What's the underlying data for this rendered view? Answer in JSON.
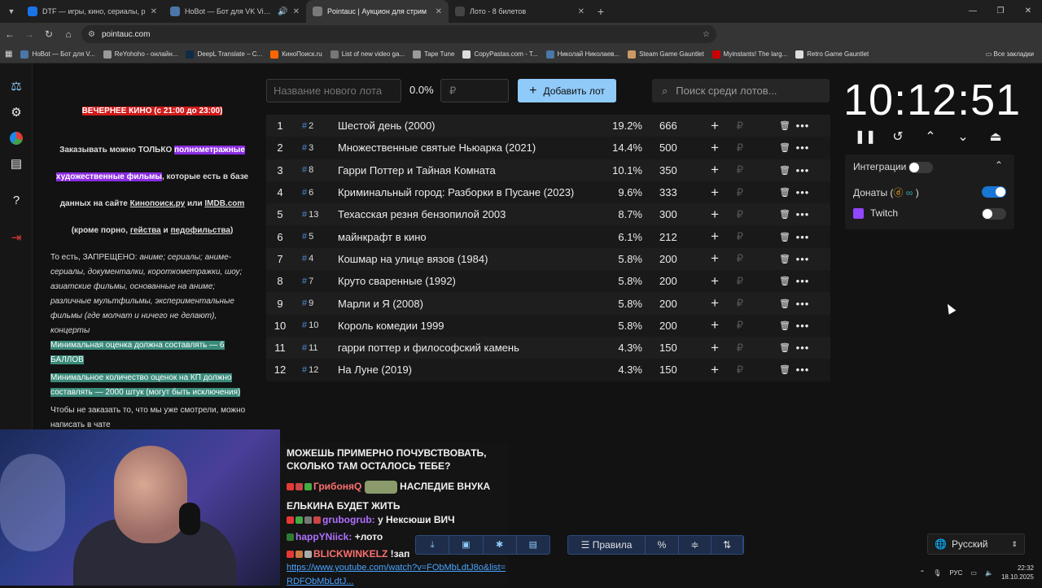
{
  "browser": {
    "tabs": [
      {
        "title": "DTF — игры, кино, сериалы, р",
        "color": "#1a73e8",
        "active": false
      },
      {
        "title": "HoBot — Бот для VK Videc",
        "color": "#4a76a8",
        "active": false
      },
      {
        "title": "Pointauc | Аукцион для стрим",
        "color": "#7a7a7a",
        "active": true
      },
      {
        "title": "Лото - 8 билетов",
        "color": "#444",
        "active": false
      }
    ],
    "url": "pointauc.com",
    "bookmarks": [
      {
        "title": "HoBot — Бот для V...",
        "color": "#4a76a8"
      },
      {
        "title": "ReYohoho - онлайн...",
        "color": "#999"
      },
      {
        "title": "DeepL Translate – C...",
        "color": "#0f2b46"
      },
      {
        "title": "КиноПоиск.ru",
        "color": "#ff6600"
      },
      {
        "title": "List of new video ga...",
        "color": "#777"
      },
      {
        "title": "Tape Tune",
        "color": "#999"
      },
      {
        "title": "CopyPastas.com - T...",
        "color": "#ddd"
      },
      {
        "title": "Николай Николаев...",
        "color": "#4a76a8"
      },
      {
        "title": "Steam Game Gauntlet",
        "color": "#c96"
      },
      {
        "title": "Myinstants! The larg...",
        "color": "#c00"
      },
      {
        "title": "Retro Game Gauntlet",
        "color": "#ddd"
      }
    ],
    "all_bookmarks": "Все закладки"
  },
  "rules": {
    "evening": "ВЕЧЕРНЕЕ КИНО (с 21:00 до 23:00)",
    "order_prefix": "Заказывать можно ТОЛЬКО ",
    "order_hl1": "полнометражные",
    "order_hl2": "художественные фильмы",
    "order_suffix": ", которые есть в базе",
    "order_line3_a": "данных на сайте ",
    "order_kp": "Кинопоиск.ру",
    "order_line3_b": " или ",
    "order_imdb": "IMDB.com",
    "order_line4_a": "(кроме порно, ",
    "order_gay": "гейства",
    "order_line4_b": " и ",
    "order_pedo": "педофильства",
    "order_line4_c": ")",
    "forbidden_lead": "То есть, ЗАПРЕЩЕНО: ",
    "forbidden_list": "аниме; сериалы; аниме-сериалы, документалки, короткометражки, шоу; азиатские фильмы, основанные на аниме; различные мультфильмы, экспериментальные фильмы (где молчат и ничего не делают), концерты",
    "min_rating": "Минимальная оценка должна составлять — 6 БАЛЛОВ",
    "min_votes": "Минимальное количество оценок на КП должно составлять — 2000 штук (могут быть исключения)",
    "no_repeat": "Чтобы не заказать то, что мы уже смотрели, можно написать в чате"
  },
  "controls": {
    "lot_placeholder": "Название нового лота",
    "percent": "0.0%",
    "amount_placeholder": "₽",
    "add_label": "Добавить лот",
    "search_placeholder": "Поиск среди лотов..."
  },
  "lots": [
    {
      "n": "1",
      "id": "2",
      "name": "Шестой день (2000)",
      "pct": "19.2%",
      "amt": "666"
    },
    {
      "n": "2",
      "id": "3",
      "name": "Множественные святые Ньюарка (2021)",
      "pct": "14.4%",
      "amt": "500"
    },
    {
      "n": "3",
      "id": "8",
      "name": "Гарри Поттер и Тайная Комната",
      "pct": "10.1%",
      "amt": "350"
    },
    {
      "n": "4",
      "id": "6",
      "name": "Криминальный город: Разборки в Пусане (2023)",
      "pct": "9.6%",
      "amt": "333"
    },
    {
      "n": "5",
      "id": "13",
      "name": "Техасская резня бензопилой 2003",
      "pct": "8.7%",
      "amt": "300"
    },
    {
      "n": "6",
      "id": "5",
      "name": "майнкрафт в кино",
      "pct": "6.1%",
      "amt": "212"
    },
    {
      "n": "7",
      "id": "4",
      "name": "Кошмар на улице вязов (1984)",
      "pct": "5.8%",
      "amt": "200"
    },
    {
      "n": "8",
      "id": "7",
      "name": "Круто сваренные (1992)",
      "pct": "5.8%",
      "amt": "200"
    },
    {
      "n": "9",
      "id": "9",
      "name": "Марли и Я (2008)",
      "pct": "5.8%",
      "amt": "200"
    },
    {
      "n": "10",
      "id": "10",
      "name": "Король комедии 1999",
      "pct": "5.8%",
      "amt": "200"
    },
    {
      "n": "11",
      "id": "11",
      "name": "гарри поттер и философский камень",
      "pct": "4.3%",
      "amt": "150"
    },
    {
      "n": "12",
      "id": "12",
      "name": "На Луне (2019)",
      "pct": "4.3%",
      "amt": "150"
    }
  ],
  "timer": {
    "value": "10:12:51"
  },
  "integrations": {
    "title": "Интеграции",
    "donations_label": "Донаты (",
    "donations_close": ")",
    "twitch_label": "Twitch"
  },
  "chat": {
    "m1": "МОЖЕШЬ ПРИМЕРНО ПОЧУВСТВОВАТЬ, СКОЛЬКО ТАМ ОСТАЛОСЬ ТЕБЕ?",
    "m2_nick": "ГрибоняQ",
    "m2_text": "НАСЛЕДИЕ ВНУКА ЕЛЬКИНА БУДЕТ ЖИТЬ",
    "m3_nick": "grubogrub:",
    "m3_text": "у Нексюши ВИЧ",
    "m4_nick": "happYNiick:",
    "m4_text": "+лото",
    "m5_nick": "BLICKWINKELZ",
    "m5_text": "!зап",
    "m5_link": "https://www.youtube.com/watch?v=FObMbLdtJ8o&list=RDFObMbLdtJ..."
  },
  "bottom": {
    "rules_label": "Правила",
    "percent_sym": "%",
    "language": "Русский"
  },
  "tray": {
    "lang": "РУС",
    "time": "22:32",
    "date": "18.10.2025"
  }
}
